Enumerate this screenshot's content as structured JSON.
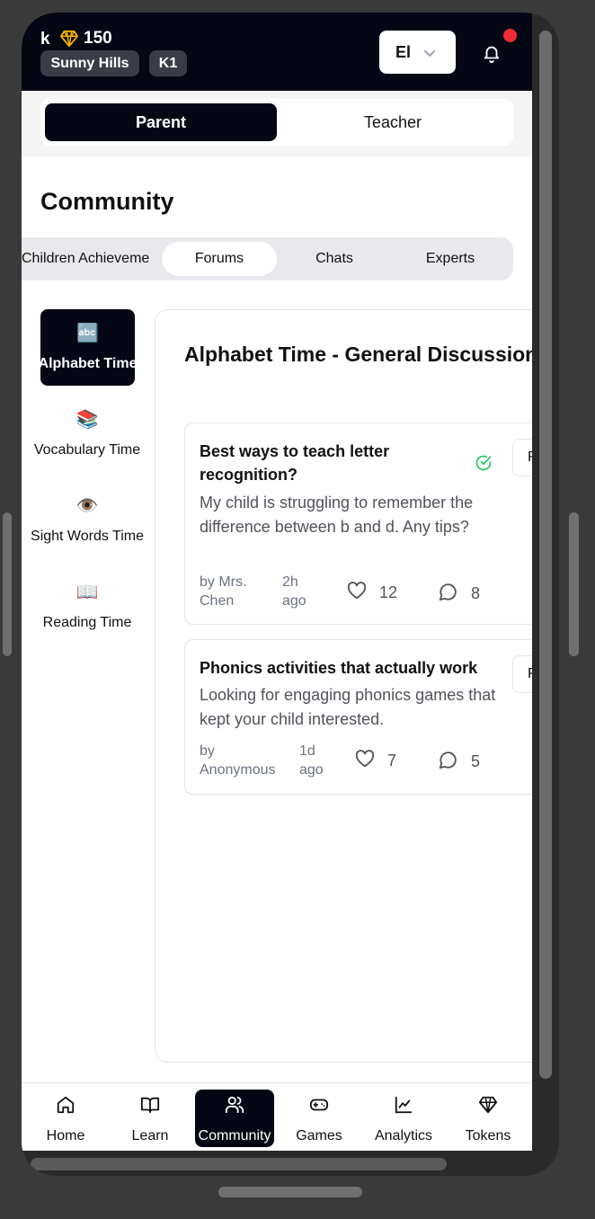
{
  "header": {
    "user_initial": "k",
    "tokens": "150",
    "school": "Sunny Hills",
    "grade": "K1",
    "language": "El",
    "has_notification": true
  },
  "role_toggle": {
    "options": [
      "Parent",
      "Teacher"
    ],
    "selected": "Parent"
  },
  "page": {
    "title": "Community"
  },
  "tabs": {
    "items": [
      "Children Achievements",
      "Forums",
      "Chats",
      "Experts"
    ],
    "visible_first": "Children Achieveme",
    "selected": "Forums"
  },
  "sidebar": {
    "items": [
      {
        "emoji": "🔤",
        "label": "Alphabet Time",
        "active": true
      },
      {
        "emoji": "📚",
        "label": "Vocabulary Time",
        "active": false
      },
      {
        "emoji": "👁️",
        "label": "Sight Words Time",
        "active": false
      },
      {
        "emoji": "📖",
        "label": "Reading Time",
        "active": false
      }
    ]
  },
  "forum": {
    "title": "Alphabet Time - General Discussion",
    "posts": [
      {
        "title": "Best ways to teach letter recognition?",
        "body": "My child is struggling to remember the difference between b and d. Any tips?",
        "author_prefix": "by Mrs.",
        "author_name": "Chen",
        "time_value": "2h",
        "time_unit": "ago",
        "likes": "12",
        "comments": "8",
        "answered": true,
        "action_label": "R"
      },
      {
        "title": "Phonics activities that actually work",
        "body": "Looking for engaging phonics games that kept your child interested.",
        "author_prefix": "by",
        "author_name": "Anonymous",
        "time_value": "1d",
        "time_unit": "ago",
        "likes": "7",
        "comments": "5",
        "answered": false,
        "action_label": "R"
      }
    ]
  },
  "bottom_nav": {
    "items": [
      {
        "label": "Home",
        "icon": "home-icon"
      },
      {
        "label": "Learn",
        "icon": "book-open-icon"
      },
      {
        "label": "Community",
        "icon": "users-icon"
      },
      {
        "label": "Games",
        "icon": "gamepad-icon"
      },
      {
        "label": "Analytics",
        "icon": "chart-line-icon"
      },
      {
        "label": "Tokens",
        "icon": "gem-icon"
      }
    ],
    "selected": "Community"
  },
  "colors": {
    "header_bg": "#050814",
    "notification_dot": "#ef2b38",
    "gem": "#f5b400",
    "answered_check": "#22c55e"
  }
}
